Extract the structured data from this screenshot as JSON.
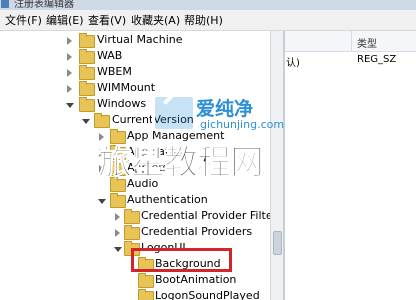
{
  "window": {
    "title": "注册表编辑器"
  },
  "menu": [
    "文件(F)",
    "编辑(E)",
    "查看(V)",
    "收藏夹(A)",
    "帮助(H)"
  ],
  "columns": {
    "type_header": "类型"
  },
  "value_row": {
    "name_fragment": "认)",
    "type": "REG_SZ"
  },
  "tree": [
    {
      "label": "Virtual Machine",
      "expander": "collapsed"
    },
    {
      "label": "WAB",
      "expander": "collapsed"
    },
    {
      "label": "WBEM",
      "expander": "collapsed"
    },
    {
      "label": "WIMMount",
      "expander": "collapsed"
    },
    {
      "label": "Windows",
      "expander": "expanded"
    },
    {
      "label": "CurrentVersion",
      "expander": "expanded"
    },
    {
      "label": "App Management",
      "expander": "collapsed"
    },
    {
      "label": "App Paths",
      "expander": "collapsed"
    },
    {
      "label": "Applets",
      "expander": "collapsed"
    },
    {
      "label": "Audio",
      "expander": "none"
    },
    {
      "label": "Authentication",
      "expander": "expanded"
    },
    {
      "label": "Credential Provider Filters",
      "expander": "collapsed"
    },
    {
      "label": "Credential Providers",
      "expander": "collapsed"
    },
    {
      "label": "LogonUI",
      "expander": "expanded"
    },
    {
      "label": "Background",
      "expander": "none",
      "selected": true
    },
    {
      "label": "BootAnimation",
      "expander": "none"
    },
    {
      "label": "LogonSoundPlayed",
      "expander": "none"
    }
  ],
  "watermark": {
    "brand": "爱纯净",
    "url": "gichunjing.com",
    "big": "旅星教程网"
  },
  "colors": {
    "highlight": "#d0262b",
    "folder": "#e8c457",
    "watermark_blue": "#2d8fd5"
  }
}
